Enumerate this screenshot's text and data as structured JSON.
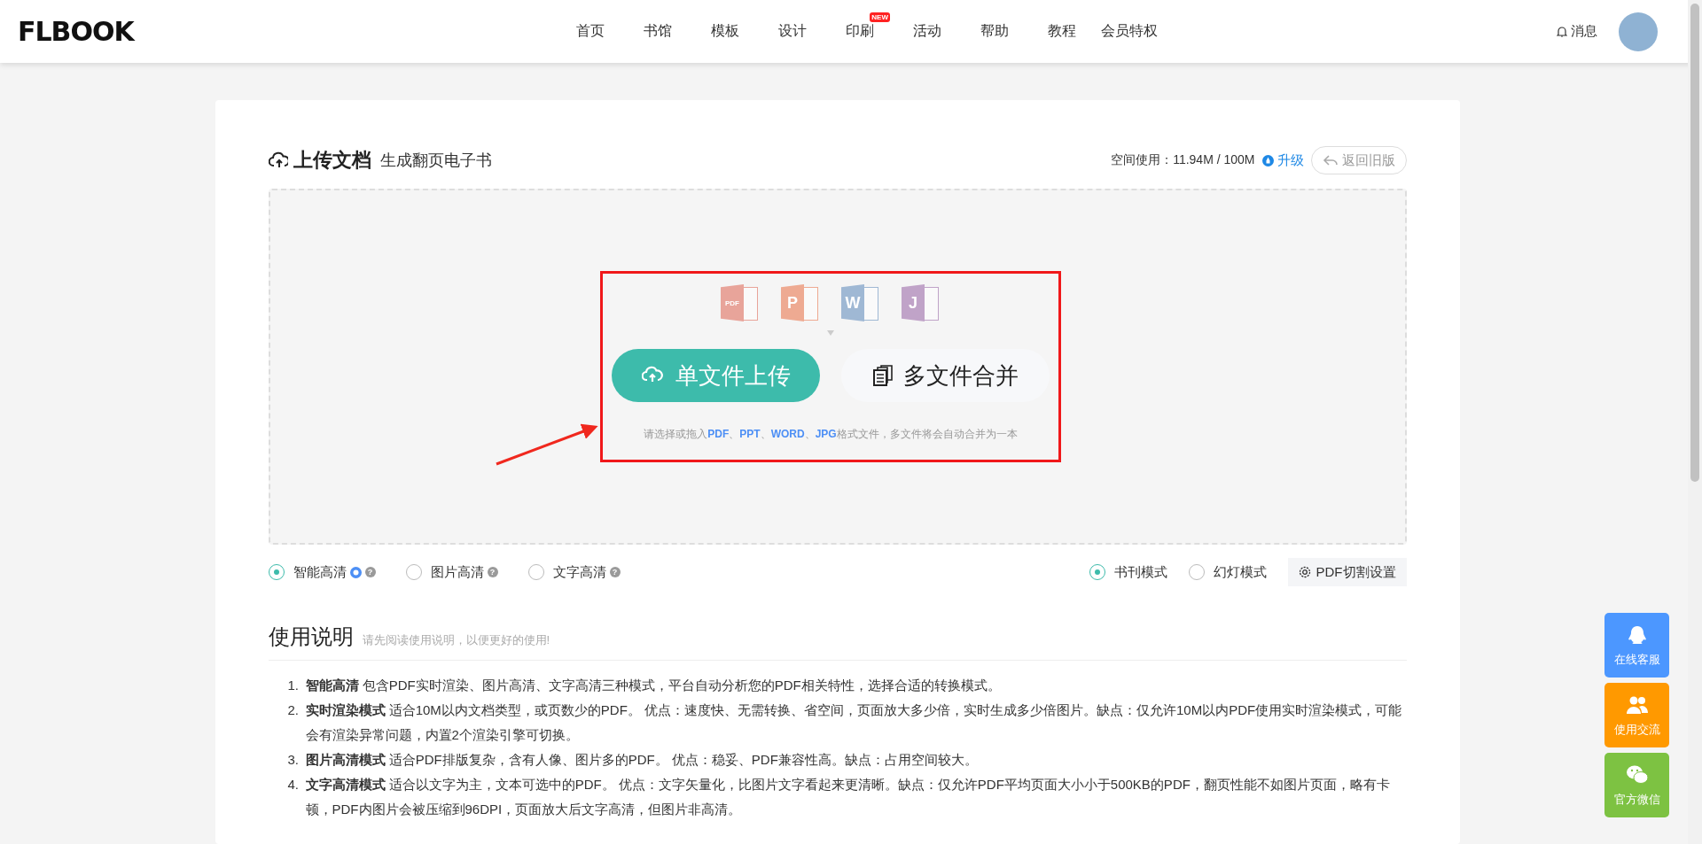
{
  "header": {
    "logo": "FLBOOK",
    "nav": [
      {
        "label": "首页"
      },
      {
        "label": "书馆"
      },
      {
        "label": "模板"
      },
      {
        "label": "设计"
      },
      {
        "label": "印刷",
        "badge": "NEW"
      },
      {
        "label": "活动"
      },
      {
        "label": "帮助"
      },
      {
        "label": "教程"
      },
      {
        "label": "会员特权"
      }
    ],
    "messages": "消息"
  },
  "upload": {
    "title": "上传文档",
    "subtitle": "生成翻页电子书",
    "space_label": "空间使用：11.94M / 100M",
    "upgrade": "升级",
    "back_button": "返回旧版",
    "file_types": [
      {
        "kind": "pdf",
        "letter": "PDF"
      },
      {
        "kind": "ppt",
        "letter": "P"
      },
      {
        "kind": "word",
        "letter": "W"
      },
      {
        "kind": "jpg",
        "letter": "J"
      }
    ],
    "buttons": [
      {
        "kind": "primary",
        "label": "单文件上传"
      },
      {
        "kind": "secondary",
        "label": "多文件合并"
      }
    ],
    "hint": "请选择或拖入**PDF**、**PPT**、**WORD**、**JPG**格式文件，多文件将会自动合并为一本"
  },
  "quality_options": [
    {
      "label": "智能高清",
      "selected": true,
      "recommended": true,
      "help": "?"
    },
    {
      "label": "图片高清",
      "selected": false,
      "recommended": false,
      "help": "?"
    },
    {
      "label": "文字高清",
      "selected": false,
      "recommended": false,
      "help": "?"
    }
  ],
  "mode_options": [
    {
      "label": "书刊模式",
      "selected": true
    },
    {
      "label": "幻灯模式",
      "selected": false
    }
  ],
  "pdf_split_button": "PDF切割设置",
  "instructions": {
    "title": "使用说明",
    "subtitle": "请先阅读使用说明，以便更好的使用!",
    "items": [
      {
        "number": "1.",
        "text": "**智能高清** 包含PDF实时渲染、图片高清、文字高清三种模式，平台自动分析您的PDF相关特性，选择合适的转换模式。"
      },
      {
        "number": "2.",
        "text": "**实时渲染模式** 适合10M以内文档类型，或页数少的PDF。 优点：速度快、无需转换、省空间，页面放大多少倍，实时生成多少倍图片。缺点：仅允许10M以内PDF使用实时渲染模式，可能会有渲染异常问题，内置2个渲染引擎可切换。"
      },
      {
        "number": "3.",
        "text": "**图片高清模式** 适合PDF排版复杂，含有人像、图片多的PDF。 优点：稳妥、PDF兼容性高。缺点：占用空间较大。"
      },
      {
        "number": "4.",
        "text": "**文字高清模式** 适合以文字为主，文本可选中的PDF。 优点：文字矢量化，比图片文字看起来更清晰。缺点：仅允许PDF平均页面大小小于500KB的PDF，翻页性能不如图片页面，略有卡顿，PDF内图片会被压缩到96DPI，页面放大后文字高清，但图片非高清。"
      }
    ]
  },
  "side_buttons": [
    {
      "kind": "qq",
      "label": "在线客服",
      "color": "#4c97ff"
    },
    {
      "kind": "users",
      "label": "使用交流",
      "color": "#ff9900"
    },
    {
      "kind": "wechat",
      "label": "官方微信",
      "color": "#7dc242"
    }
  ]
}
